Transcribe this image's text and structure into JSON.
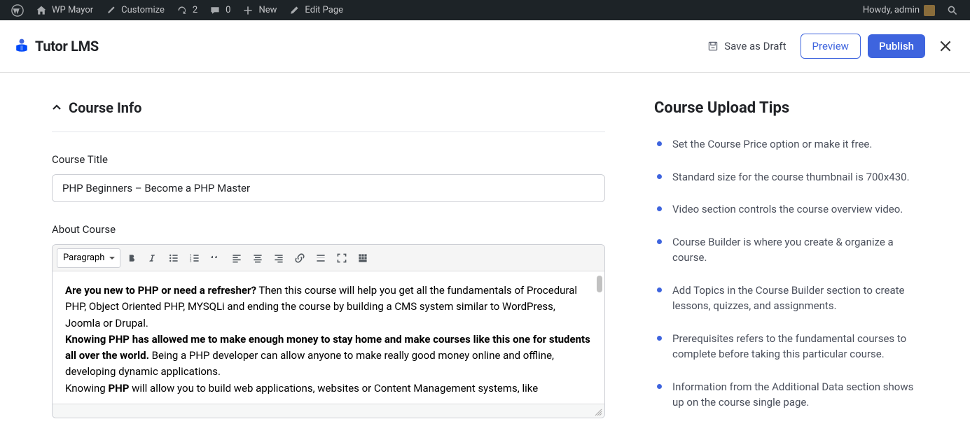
{
  "adminbar": {
    "site_name": "WP Mayor",
    "customize": "Customize",
    "updates_count": "2",
    "comments_count": "0",
    "new": "New",
    "edit_page": "Edit Page",
    "howdy": "Howdy, admin"
  },
  "brand": {
    "name": "Tutor LMS"
  },
  "topbar": {
    "save_draft": "Save as Draft",
    "preview": "Preview",
    "publish": "Publish"
  },
  "course_info": {
    "section_title": "Course Info",
    "title_label": "Course Title",
    "title_value": "PHP Beginners – Become a PHP Master",
    "about_label": "About Course",
    "format_selected": "Paragraph",
    "content": {
      "line1_bold": "Are you new to PHP or need a refresher?",
      "line1_rest": " Then this course will help you get all the fundamentals of Procedural PHP, Object Oriented PHP, MYSQLi and ending the course by building a CMS system similar to WordPress, Joomla or Drupal.",
      "line2_bold": "Knowing PHP has allowed me to make enough money to stay home and make courses like this one for students all over the world.",
      "line2_rest": " Being a PHP developer can allow anyone to make really good money online and offline, developing dynamic applications.",
      "line3_pre": "Knowing ",
      "line3_bold": "PHP",
      "line3_rest": " will allow you to build web applications, websites or Content Management systems, like"
    }
  },
  "tips": {
    "title": "Course Upload Tips",
    "items": [
      "Set the Course Price option or make it free.",
      "Standard size for the course thumbnail is 700x430.",
      "Video section controls the course overview video.",
      "Course Builder is where you create & organize a course.",
      "Add Topics in the Course Builder section to create lessons, quizzes, and assignments.",
      "Prerequisites refers to the fundamental courses to complete before taking this particular course.",
      "Information from the Additional Data section shows up on the course single page."
    ]
  }
}
